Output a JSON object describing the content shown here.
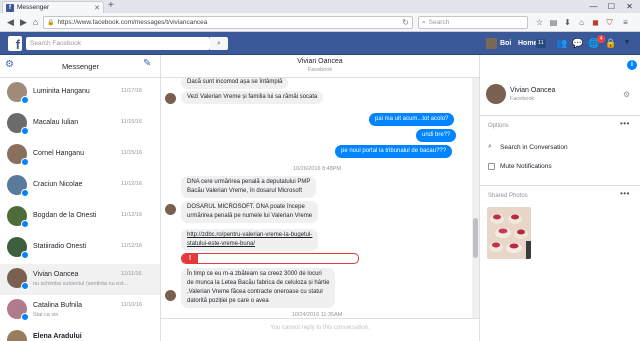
{
  "browser": {
    "tab_title": "Messenger",
    "url": "https://www.facebook.com/messages/t/viviancancea",
    "search_placeholder": "Search"
  },
  "fbbar": {
    "search_placeholder": "Search Facebook",
    "user": "Boi",
    "home": "Home",
    "home_count": "11",
    "notif_count": "4"
  },
  "left": {
    "title": "Messenger",
    "conversations": [
      {
        "name": "Luminita Hanganu",
        "date": "11/17/16",
        "snippet": ""
      },
      {
        "name": "Macalau Iulian",
        "date": "11/15/16",
        "snippet": ""
      },
      {
        "name": "Cornel Hanganu",
        "date": "11/15/16",
        "snippet": ""
      },
      {
        "name": "Craciun Nicolae",
        "date": "11/12/16",
        "snippet": ""
      },
      {
        "name": "Bogdan de la Onesti",
        "date": "11/12/16",
        "snippet": ""
      },
      {
        "name": "Statiiradio Onesti",
        "date": "11/12/16",
        "snippet": ""
      },
      {
        "name": "Vivian Oancea",
        "date": "11/11/16",
        "snippet": "nu schimba subiectul (sentinta nu est..."
      },
      {
        "name": "Catalina Bufnila",
        "date": "11/10/16",
        "snippet": "Stai ca vin"
      },
      {
        "name": "Elena Aradului",
        "date": "",
        "snippet": ""
      }
    ]
  },
  "thread": {
    "header_name": "Vivian Oancea",
    "header_sub": "Facebook",
    "m1": "Dacă sunt incomod așa se întâmplă",
    "m2": "Vezi Valerian Vreme și familia lui sa rămâi socata",
    "o1": "pai ma uit acum...tot acolo?",
    "o2": "undi bre??",
    "o3": "pe noul portal la tribunalul de bacau???",
    "stamp1": "10/26/2016 8:48PM",
    "m3a": "DNA cere urmărirea penală a deputatului PMP",
    "m3b": "Bacău Valerian Vreme, în dosarul Microsoft",
    "m4a": "DOSARUL MICROSOFT. DNA poate începe",
    "m4b": "urmărirea penală pe numele lui Valerian Vreme",
    "link_a": "http://zdbc.ro/pentru-valerian-vreme-la-bugetul-",
    "link_b": "statului-este-vreme-buna/",
    "warn_icon": "!",
    "m5a": "În timp ce eu m-a zbăteam sa creez 3000 de locuri",
    "m5b": "de munca la Letea Bacău fabrica de celuloza și hârtie",
    "m5c": ",Valerian Vreme făcea contracte oneroase cu statul",
    "m5d": "datorită poziției pe care o avea",
    "stamp2": "10/24/2016 11:35AM",
    "noreply": "You cannot reply to this conversation."
  },
  "right": {
    "name": "Vivian Oancea",
    "sub": "Facebook",
    "options_label": "Options",
    "opt_search": "Search in Conversation",
    "opt_mute": "Mute Notifications",
    "photos_label": "Shared Photos"
  }
}
